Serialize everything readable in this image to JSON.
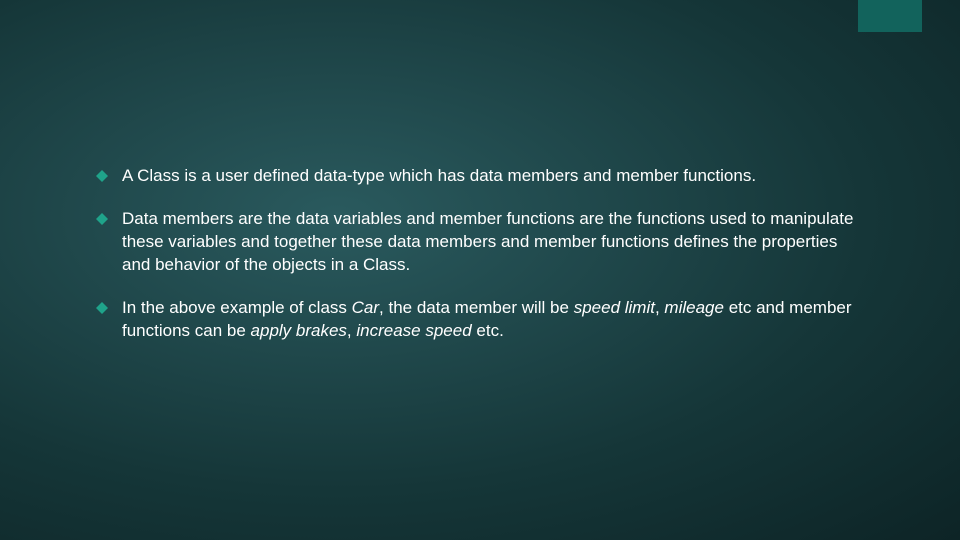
{
  "bullets": [
    {
      "segments": [
        {
          "text": "A Class is a user defined data-type which has data members and member functions.",
          "italic": false
        }
      ]
    },
    {
      "segments": [
        {
          "text": "Data members are the data variables and member functions are the functions used to manipulate these variables and together these data members and member functions defines the properties and behavior of the objects in a Class.",
          "italic": false
        }
      ]
    },
    {
      "segments": [
        {
          "text": "In the above example of class ",
          "italic": false
        },
        {
          "text": "Car",
          "italic": true
        },
        {
          "text": ", the data member will be ",
          "italic": false
        },
        {
          "text": "speed limit",
          "italic": true
        },
        {
          "text": ", ",
          "italic": false
        },
        {
          "text": "mileage",
          "italic": true
        },
        {
          "text": " etc and member functions can be ",
          "italic": false
        },
        {
          "text": "apply brakes",
          "italic": true
        },
        {
          "text": ", ",
          "italic": false
        },
        {
          "text": "increase speed",
          "italic": true
        },
        {
          "text": " etc.",
          "italic": false
        }
      ]
    }
  ],
  "accentColor": "#12635c",
  "bulletColor": "#1fa38a"
}
